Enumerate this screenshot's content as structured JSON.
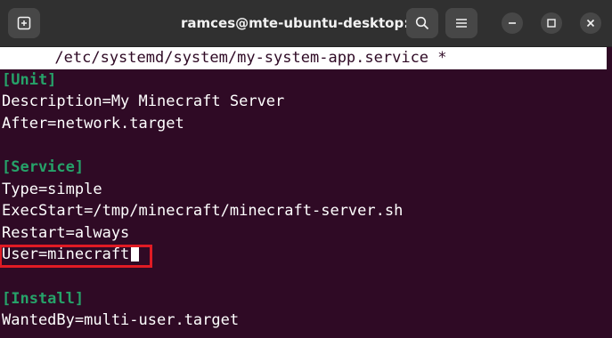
{
  "window": {
    "title": "ramces@mte-ubuntu-desktop: ~"
  },
  "editor": {
    "header": "      /etc/systemd/system/my-system-app.service *",
    "lines": [
      "[Unit]",
      "Description=My Minecraft Server",
      "After=network.target",
      "",
      "[Service]",
      "Type=simple",
      "ExecStart=/tmp/minecraft/minecraft-server.sh",
      "Restart=always",
      "User=minecraft",
      "",
      "[Install]",
      "WantedBy=multi-user.target"
    ]
  },
  "icons": {
    "new_tab": "new-tab-icon",
    "search": "search-icon",
    "menu": "hamburger-menu-icon",
    "minimize": "minimize-icon",
    "maximize": "maximize-icon",
    "close": "close-icon"
  },
  "colors": {
    "background": "#2f0a25",
    "section_header": "#26a269",
    "highlight_border": "#e01b24",
    "titlebar": "#303030"
  }
}
